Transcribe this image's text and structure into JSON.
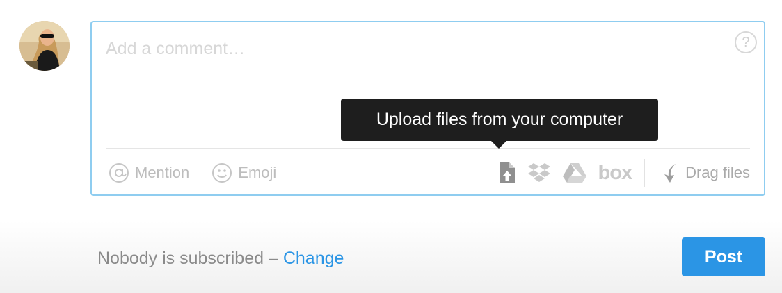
{
  "comment": {
    "placeholder": "Add a comment…",
    "value": "",
    "help_symbol": "?"
  },
  "toolbar": {
    "mention_label": "Mention",
    "emoji_label": "Emoji",
    "services": [
      {
        "icon": "upload-file-icon"
      },
      {
        "icon": "dropbox-icon"
      },
      {
        "icon": "google-drive-icon"
      },
      {
        "icon": "box-icon",
        "label": "box"
      }
    ],
    "drag_label": "Drag files"
  },
  "tooltip": {
    "text": "Upload files from your computer"
  },
  "footer": {
    "subscribed_text": "Nobody is subscribed –",
    "change_link": "Change",
    "post_label": "Post"
  },
  "colors": {
    "accent": "#2b95e5",
    "input_border": "#8fcdf0",
    "tooltip_bg": "#1e1e1e",
    "muted_text": "#8a8a8a"
  }
}
